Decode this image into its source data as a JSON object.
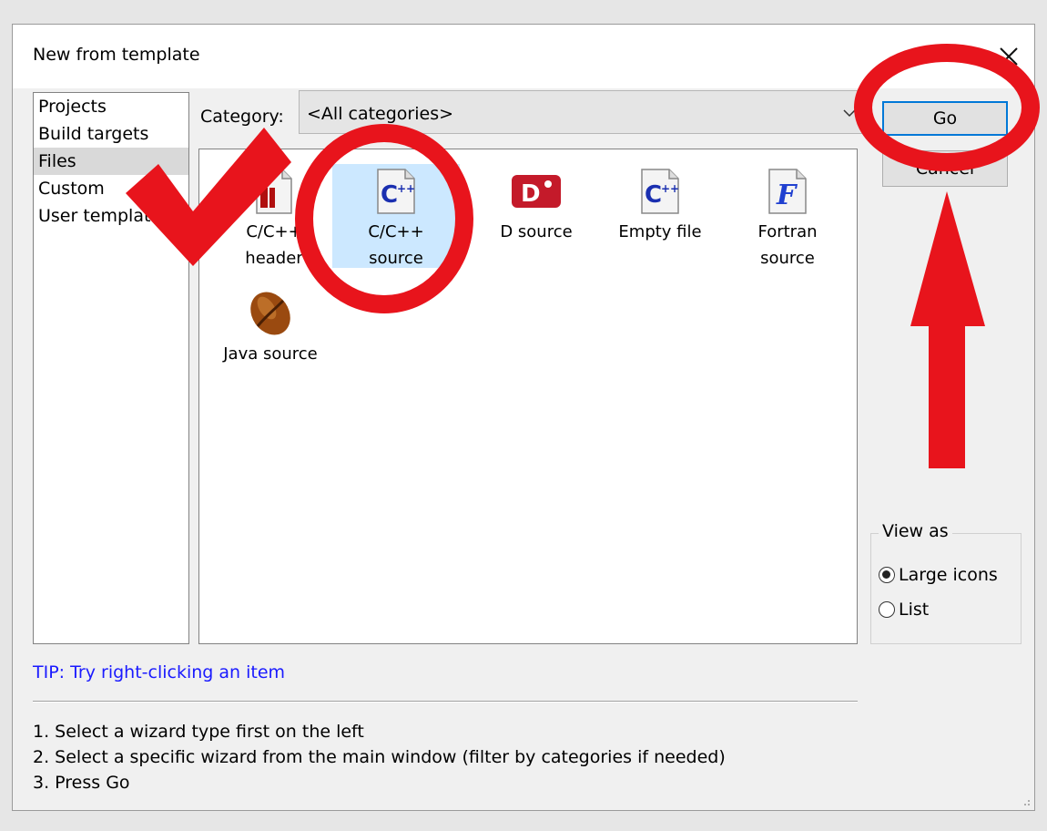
{
  "dialog": {
    "title": "New from template"
  },
  "wizard_types": [
    {
      "label": "Projects",
      "selected": false
    },
    {
      "label": "Build targets",
      "selected": false
    },
    {
      "label": "Files",
      "selected": true
    },
    {
      "label": "Custom",
      "selected": false
    },
    {
      "label": "User templates",
      "selected": false
    }
  ],
  "category": {
    "label": "Category:",
    "value": "<All categories>"
  },
  "templates": [
    {
      "label_line1": "C/C++",
      "label_line2": "header",
      "icon": "c-header-icon",
      "selected": false
    },
    {
      "label_line1": "C/C++",
      "label_line2": "source",
      "icon": "cpp-source-icon",
      "selected": true
    },
    {
      "label_line1": "D source",
      "label_line2": "",
      "icon": "d-source-icon",
      "selected": false
    },
    {
      "label_line1": "Empty file",
      "label_line2": "",
      "icon": "empty-file-icon",
      "selected": false
    },
    {
      "label_line1": "Fortran",
      "label_line2": "source",
      "icon": "fortran-source-icon",
      "selected": false
    },
    {
      "label_line1": "Java source",
      "label_line2": "",
      "icon": "java-source-icon",
      "selected": false
    }
  ],
  "buttons": {
    "go": "Go",
    "cancel": "Cancel"
  },
  "view_as": {
    "legend": "View as",
    "options": [
      {
        "label": "Large icons",
        "checked": true
      },
      {
        "label": "List",
        "checked": false
      }
    ]
  },
  "tip": "TIP: Try right-clicking an item",
  "instructions": [
    "1. Select a wizard type first on the left",
    "2. Select a specific wizard from the main window (filter by categories if needed)",
    "3. Press Go"
  ],
  "annotations": {
    "color": "#e8141c",
    "marks": [
      "checkmark",
      "circle-cpp-source",
      "circle-go-button",
      "arrow-up-to-go"
    ]
  }
}
